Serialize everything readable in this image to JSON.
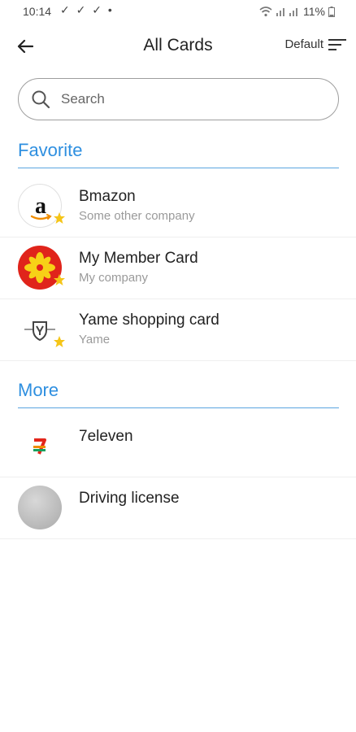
{
  "status_bar": {
    "time": "10:14",
    "notification_checks": "✓ ✓ ✓ •",
    "battery": "11%"
  },
  "app_bar": {
    "title": "All Cards",
    "sort_label": "Default"
  },
  "search": {
    "placeholder": "Search"
  },
  "sections": {
    "favorite": "Favorite",
    "more": "More"
  },
  "favorite_cards": [
    {
      "name": "Bmazon",
      "company": "Some other company",
      "logo_icon": "amazon-a-icon"
    },
    {
      "name": "My Member Card",
      "company": "My company",
      "logo_icon": "red-star-burst-icon"
    },
    {
      "name": "Yame shopping card",
      "company": "Yame",
      "logo_icon": "yame-shield-icon"
    }
  ],
  "more_cards": [
    {
      "name": "7eleven",
      "company": "",
      "logo_icon": "seven-eleven-icon"
    },
    {
      "name": "Driving license",
      "company": "",
      "logo_icon": "gray-circle-icon"
    }
  ],
  "colors": {
    "accent": "#2e8fe0",
    "star": "#f5c518",
    "divider": "#5aa5e0"
  }
}
